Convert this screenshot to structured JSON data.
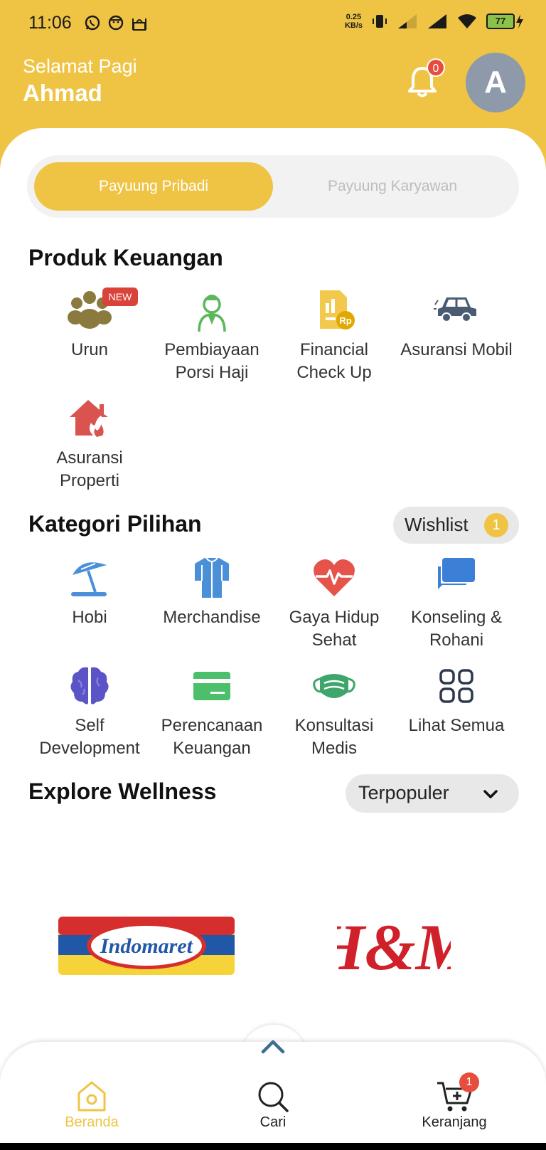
{
  "status_bar": {
    "time": "11:06",
    "net_speed_value": "0.25",
    "net_speed_unit": "KB/s",
    "battery": "77"
  },
  "header": {
    "greeting": "Selamat Pagi",
    "name": "Ahmad",
    "notification_count": "0",
    "avatar_initial": "A",
    "accent_color": "#EFC445"
  },
  "segment": {
    "active": "Payuung Pribadi",
    "inactive": "Payuung Karyawan"
  },
  "produk": {
    "title": "Produk Keuangan",
    "new_badge": "NEW",
    "items": [
      {
        "l1": "Urun",
        "l2": "",
        "icon": "people-icon"
      },
      {
        "l1": "Pembiayaan",
        "l2": "Porsi Haji",
        "icon": "hajj-person-icon"
      },
      {
        "l1": "Financial",
        "l2": "Check Up",
        "icon": "financial-report-icon"
      },
      {
        "l1": "Asuransi Mobil",
        "l2": "",
        "icon": "car-icon"
      },
      {
        "l1": "Asuransi",
        "l2": "Properti",
        "icon": "house-fire-icon"
      }
    ]
  },
  "kategori": {
    "title": "Kategori Pilihan",
    "wishlist_label": "Wishlist",
    "wishlist_count": "1",
    "items": [
      {
        "l1": "Hobi",
        "l2": "",
        "icon": "beach-umbrella-icon"
      },
      {
        "l1": "Merchandise",
        "l2": "",
        "icon": "shirt-icon"
      },
      {
        "l1": "Gaya Hidup",
        "l2": "Sehat",
        "icon": "heart-pulse-icon"
      },
      {
        "l1": "Konseling &",
        "l2": "Rohani",
        "icon": "chat-bubbles-icon"
      },
      {
        "l1": "Self",
        "l2": "Development",
        "icon": "brain-icon"
      },
      {
        "l1": "Perencanaan",
        "l2": "Keuangan",
        "icon": "card-icon"
      },
      {
        "l1": "Konsultasi",
        "l2": "Medis",
        "icon": "face-mask-icon"
      },
      {
        "l1": "Lihat Semua",
        "l2": "",
        "icon": "grid-icon"
      }
    ]
  },
  "explore": {
    "title": "Explore Wellness",
    "sort_label": "Terpopuler",
    "brands": [
      "Indomaret",
      "H&M"
    ]
  },
  "bottom_nav": {
    "items": [
      {
        "label": "Beranda",
        "icon": "home-icon",
        "active": true
      },
      {
        "label": "Cari",
        "icon": "search-icon",
        "active": false
      },
      {
        "label": "Keranjang",
        "icon": "cart-icon",
        "active": false
      }
    ],
    "cart_count": "1"
  }
}
